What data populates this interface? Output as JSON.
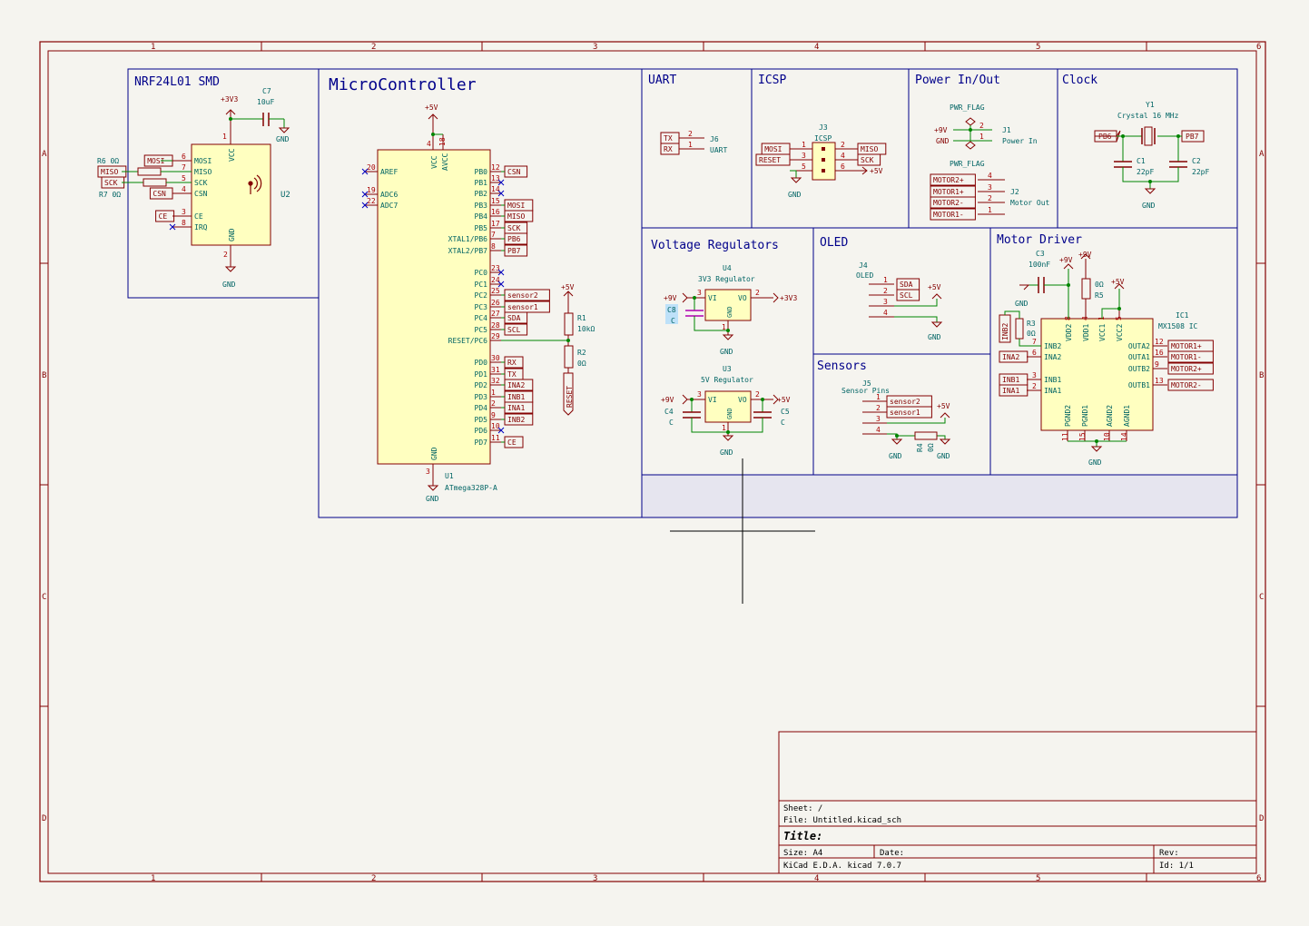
{
  "colors": {
    "background": "#f5f4ef",
    "frame": "#840000",
    "box": "#00008a",
    "wire": "#008400",
    "pin": "#840000",
    "pinnum": "#a90000",
    "text": "#006464",
    "body_fill": "#ffffc0",
    "label": "#840000",
    "section_title": "#00008a",
    "selected": "#b000b0",
    "highlight": "#9ad4ff",
    "empty_fill": "#e6e5ef"
  },
  "border": {
    "columns": [
      "1",
      "2",
      "3",
      "4",
      "5",
      "6"
    ],
    "rows": [
      "A",
      "B",
      "C",
      "D"
    ]
  },
  "sections": {
    "nrf": "NRF24L01 SMD",
    "mcu": "MicroController",
    "uart": "UART",
    "icsp": "ICSP",
    "power": "Power In/Out",
    "clock": "Clock",
    "vreg": "Voltage Regulators",
    "oled": "OLED",
    "motor": "Motor Driver",
    "sensors": "Sensors"
  },
  "nrf": {
    "ref": "U2",
    "c7_ref": "C7",
    "c7_val": "10uF",
    "pwr": "+3V3",
    "gnd": "GND",
    "r6": "R6 0Ω",
    "r7": "R7 0Ω",
    "pins": [
      {
        "num": "6",
        "name": "MOSI",
        "label": "MOSI"
      },
      {
        "num": "7",
        "name": "MISO",
        "label": "MISO"
      },
      {
        "num": "5",
        "name": "SCK",
        "label": "SCK"
      },
      {
        "num": "4",
        "name": "CSN",
        "label": "CSN"
      },
      {
        "num": "3",
        "name": "CE",
        "label": "CE"
      },
      {
        "num": "8",
        "name": "IRQ",
        "label": ""
      }
    ],
    "vcc": "VCC",
    "vcc_num": "1",
    "gnd_pin": "GND",
    "gnd_num": "2"
  },
  "mcu": {
    "ref": "U1",
    "part": "ATmega328P-A",
    "pwr": "+5V",
    "gnd": "GND",
    "gnd_num": "3",
    "top_pins": [
      {
        "num": "4",
        "name": "VCC"
      },
      {
        "num": "18",
        "name": "AVCC"
      }
    ],
    "left_pins": [
      {
        "num": "20",
        "name": "AREF"
      },
      {
        "num": "19",
        "name": "ADC6"
      },
      {
        "num": "22",
        "name": "ADC7"
      }
    ],
    "right_pins": [
      {
        "num": "12",
        "name": "PB0",
        "label": "CSN"
      },
      {
        "num": "13",
        "name": "PB1",
        "label": ""
      },
      {
        "num": "14",
        "name": "PB2",
        "label": ""
      },
      {
        "num": "15",
        "name": "PB3",
        "label": "MOSI"
      },
      {
        "num": "16",
        "name": "PB4",
        "label": "MISO"
      },
      {
        "num": "17",
        "name": "PB5",
        "label": "SCK"
      },
      {
        "num": "7",
        "name": "XTAL1/PB6",
        "label": "PB6"
      },
      {
        "num": "8",
        "name": "XTAL2/PB7",
        "label": "PB7"
      },
      {
        "num": "23",
        "name": "PC0",
        "label": ""
      },
      {
        "num": "24",
        "name": "PC1",
        "label": ""
      },
      {
        "num": "25",
        "name": "PC2",
        "label": "sensor2"
      },
      {
        "num": "26",
        "name": "PC3",
        "label": "sensor1"
      },
      {
        "num": "27",
        "name": "PC4",
        "label": "SDA"
      },
      {
        "num": "28",
        "name": "PC5",
        "label": "SCL"
      },
      {
        "num": "29",
        "name": "RESET/PC6",
        "label": ""
      },
      {
        "num": "30",
        "name": "PD0",
        "label": "RX"
      },
      {
        "num": "31",
        "name": "PD1",
        "label": "TX"
      },
      {
        "num": "32",
        "name": "PD2",
        "label": "INA2"
      },
      {
        "num": "1",
        "name": "PD3",
        "label": "INB1"
      },
      {
        "num": "2",
        "name": "PD4",
        "label": "INA1"
      },
      {
        "num": "9",
        "name": "PD5",
        "label": "INB2"
      },
      {
        "num": "10",
        "name": "PD6",
        "label": ""
      },
      {
        "num": "11",
        "name": "PD7",
        "label": "CE"
      }
    ],
    "r1": "R1",
    "r1_val": "10kΩ",
    "r2": "R2",
    "r2_val": "0Ω",
    "reset_label": "RESET",
    "r_pwr": "+5V"
  },
  "uart": {
    "ref": "J6",
    "name": "UART",
    "pins": [
      {
        "num": "2",
        "label": "TX"
      },
      {
        "num": "1",
        "label": "RX"
      }
    ]
  },
  "icsp": {
    "ref": "J3",
    "name": "ICSP",
    "pwr": "+5V",
    "gnd": "GND",
    "left": [
      {
        "num": "1",
        "label": "MOSI"
      },
      {
        "num": "3",
        "label": "RESET"
      },
      {
        "num": "5",
        "label": ""
      }
    ],
    "right": [
      {
        "num": "2",
        "label": "MISO"
      },
      {
        "num": "4",
        "label": "SCK"
      },
      {
        "num": "6",
        "label": "+5V"
      }
    ]
  },
  "power": {
    "flag": "PWR_FLAG",
    "flag2": "PWR_FLAG",
    "j1": "J1",
    "j1_name": "Power In",
    "p9v": "+9V",
    "gnd": "GND",
    "j2": "J2",
    "j2_name": "Motor Out",
    "motor_pins": [
      {
        "num": "4",
        "label": "MOTOR2+"
      },
      {
        "num": "3",
        "label": "MOTOR1+"
      },
      {
        "num": "2",
        "label": "MOTOR2-"
      },
      {
        "num": "1",
        "label": "MOTOR1-"
      }
    ]
  },
  "clock": {
    "ref": "Y1",
    "name": "Crystal 16 MHz",
    "left": "PB6",
    "right": "PB7",
    "c1": "C1",
    "c1_val": "22pF",
    "c2": "C2",
    "c2_val": "22pF",
    "gnd": "GND"
  },
  "vreg": {
    "u4": "U4",
    "u4_name": "3V3 Regulator",
    "u3": "U3",
    "u3_name": "5V Regulator",
    "vi": "VI",
    "vo": "VO",
    "gnd_pin": "GND",
    "in": "+9V",
    "out3": "+3V3",
    "out5": "+5V",
    "gnd": "GND",
    "c8": "C8",
    "c8_val": "C",
    "c4": "C4",
    "c4_val": "C",
    "c5": "C5",
    "c5_val": "C",
    "n_in": "3",
    "n_out": "2",
    "n_gnd": "1"
  },
  "oled": {
    "ref": "J4",
    "name": "OLED",
    "pwr": "+5V",
    "gnd": "GND",
    "pins": [
      {
        "num": "1",
        "label": "SDA"
      },
      {
        "num": "2",
        "label": "SCL"
      },
      {
        "num": "3",
        "label": ""
      },
      {
        "num": "4",
        "label": ""
      }
    ]
  },
  "sensors": {
    "ref": "J5",
    "name": "Sensor Pins",
    "pwr": "+5V",
    "gnd": "GND",
    "r4": "R4",
    "r4_val": "0Ω",
    "pins": [
      {
        "num": "1",
        "label": "sensor2"
      },
      {
        "num": "2",
        "label": "sensor1"
      },
      {
        "num": "3",
        "label": ""
      },
      {
        "num": "4",
        "label": ""
      }
    ]
  },
  "motor": {
    "ref": "IC1",
    "part": "MX1508 IC",
    "c3": "C3",
    "c3_val": "100nF",
    "r5": "R5",
    "r5_val": "0Ω",
    "r3": "R3",
    "r3_val": "0Ω",
    "p9v": "+9V",
    "p5v": "+5V",
    "gnd": "GND",
    "top": [
      {
        "num": "8",
        "name": "VDD2"
      },
      {
        "num": "4",
        "name": "VDD1"
      },
      {
        "num": "1",
        "name": "VCC1"
      },
      {
        "num": "5",
        "name": "VCC2"
      }
    ],
    "left": [
      {
        "num": "7",
        "name": "INB2",
        "label": "INB2"
      },
      {
        "num": "6",
        "name": "INA2",
        "label": "INA2"
      },
      {
        "num": "3",
        "name": "INB1",
        "label": "INB1"
      },
      {
        "num": "2",
        "name": "INA1",
        "label": "INA1"
      }
    ],
    "right": [
      {
        "num": "12",
        "name": "OUTA2",
        "label": "MOTOR1+"
      },
      {
        "num": "16",
        "name": "OUTA1",
        "label": "MOTOR1-"
      },
      {
        "num": "9",
        "name": "OUTB2",
        "label": "MOTOR2+"
      },
      {
        "num": "13",
        "name": "OUTB1",
        "label": "MOTOR2-"
      }
    ],
    "bottom": [
      {
        "num": "11",
        "name": "PGND2"
      },
      {
        "num": "15",
        "name": "PGND1"
      },
      {
        "num": "10",
        "name": "AGND2"
      },
      {
        "num": "14",
        "name": "AGND1"
      }
    ]
  },
  "title_block": {
    "sheet": "Sheet: /",
    "file": "File: Untitled.kicad_sch",
    "title": "Title:",
    "size": "Size: A4",
    "date": "Date:",
    "rev": "Rev:",
    "tool": "KiCad E.D.A.  kicad 7.0.7",
    "id": "Id: 1/1"
  }
}
